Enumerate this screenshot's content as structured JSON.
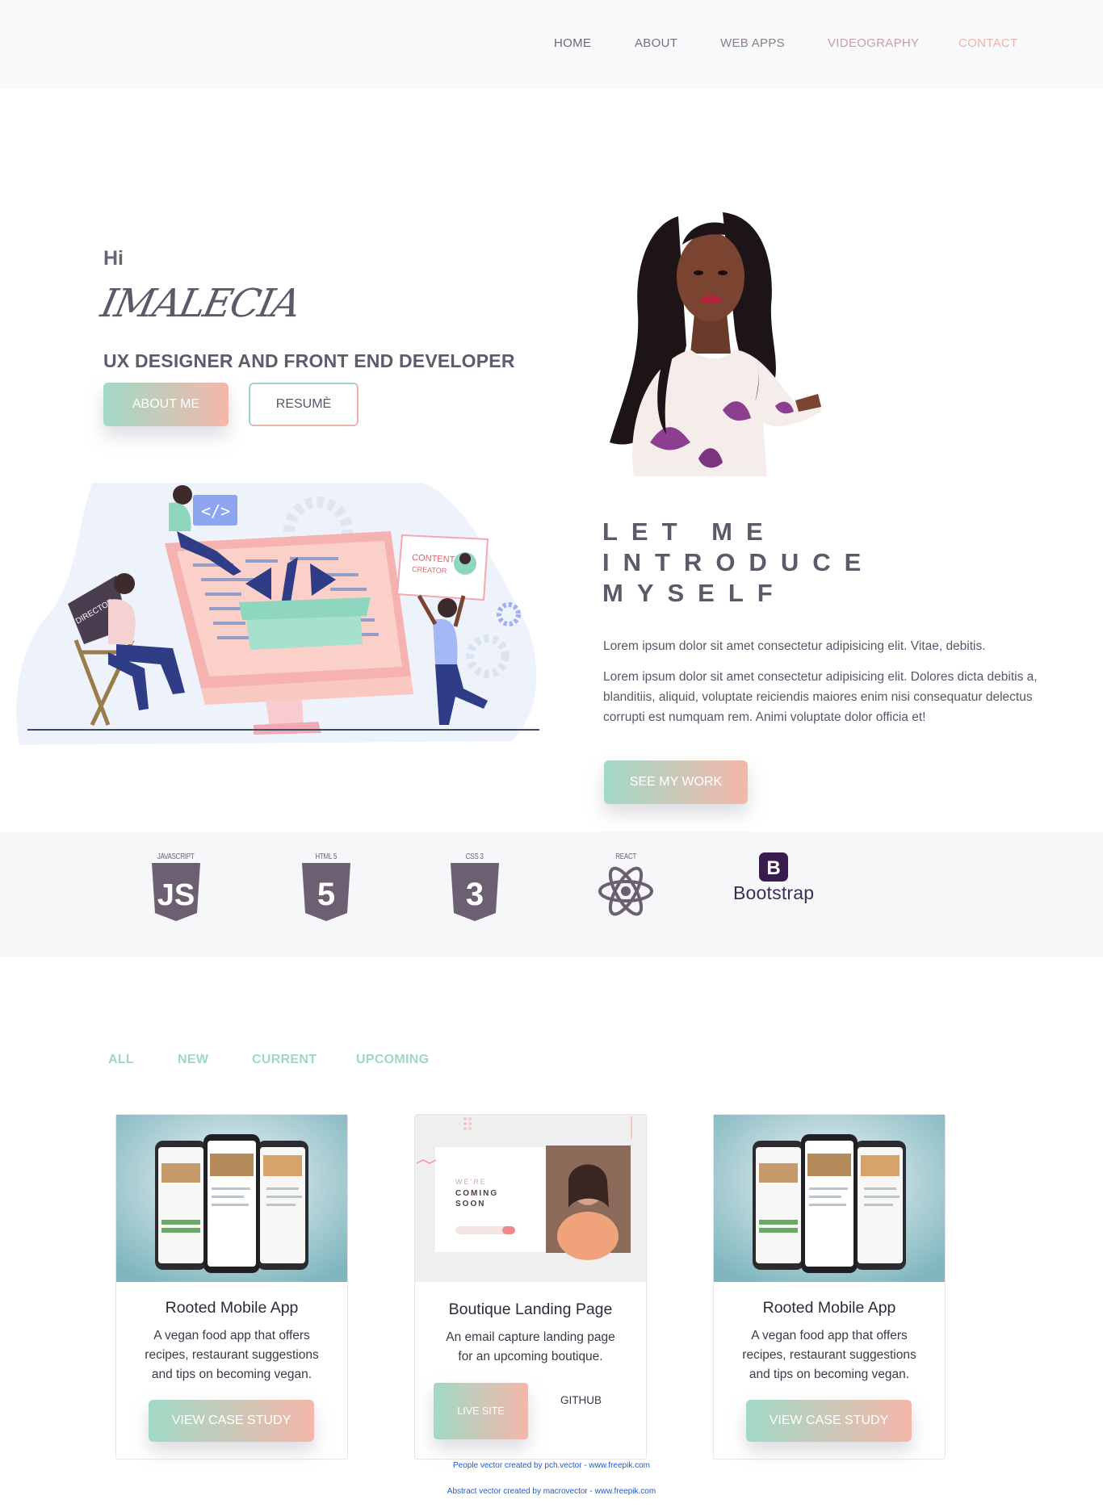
{
  "nav": {
    "items": [
      "HOME",
      "ABOUT",
      "WEB APPS",
      "VIDEOGRAPHY",
      "CONTACT"
    ]
  },
  "hero": {
    "greeting": "Hi",
    "signature": "IMALECIA",
    "role": "UX DESIGNER AND FRONT END DEVELOPER",
    "about_label": "ABOUT ME",
    "resume_label": "RESUMÈ"
  },
  "intro": {
    "title_lines": [
      "LET ME",
      "INTRODUCE",
      "MYSELF"
    ],
    "paragraph1": "Lorem ipsum dolor sit amet consectetur adipisicing elit. Vitae, debitis.",
    "paragraph2": "Lorem ipsum dolor sit amet consectetur adipisicing elit. Dolores dicta debitis a, blanditiis, aliquid, voluptate reiciendis maiores enim nisi consequatur delectus corrupti est numquam rem. Animi voluptate dolor officia et!",
    "see_work_label": "SEE MY WORK",
    "illustration_texts": [
      "DIRECTOR",
      "CONTENT",
      "CREATOR",
      "</>"
    ]
  },
  "skills": {
    "captions": [
      "JAVASCRIPT",
      "HTML 5",
      "CSS 3",
      "REACT"
    ],
    "bootstrap_label": "Bootstrap",
    "bootstrap_letter": "B",
    "js_letters": "JS",
    "html_number": "5",
    "css_number": "3"
  },
  "filters": [
    "ALL",
    "NEW",
    "CURRENT",
    "UPCOMING"
  ],
  "cards": [
    {
      "title": "Rooted Mobile App",
      "description": "A vegan food app that offers recipes, restaurant suggestions and tips on becoming vegan.",
      "button": "VIEW CASE STUDY"
    },
    {
      "title": "Boutique Landing Page",
      "description": "An email capture landing page for an upcoming boutique.",
      "live_label": "LIVE SITE",
      "github_label": "GITHUB",
      "mock_text": "WE'RE COMING SOON"
    },
    {
      "title": "Rooted Mobile App",
      "description": "A vegan food app that offers recipes, restaurant suggestions and tips on becoming vegan.",
      "button": "VIEW CASE STUDY"
    }
  ],
  "credits": [
    "People vector created by pch.vector - www.freepik.com",
    "Abstract vector created by macrovector - www.freepik.com"
  ],
  "colors": {
    "accent_mint": "#a1d9c6",
    "accent_peach": "#f4b7aa",
    "text_dark": "#5b5567",
    "nav_bg": "#f8f9fb"
  }
}
